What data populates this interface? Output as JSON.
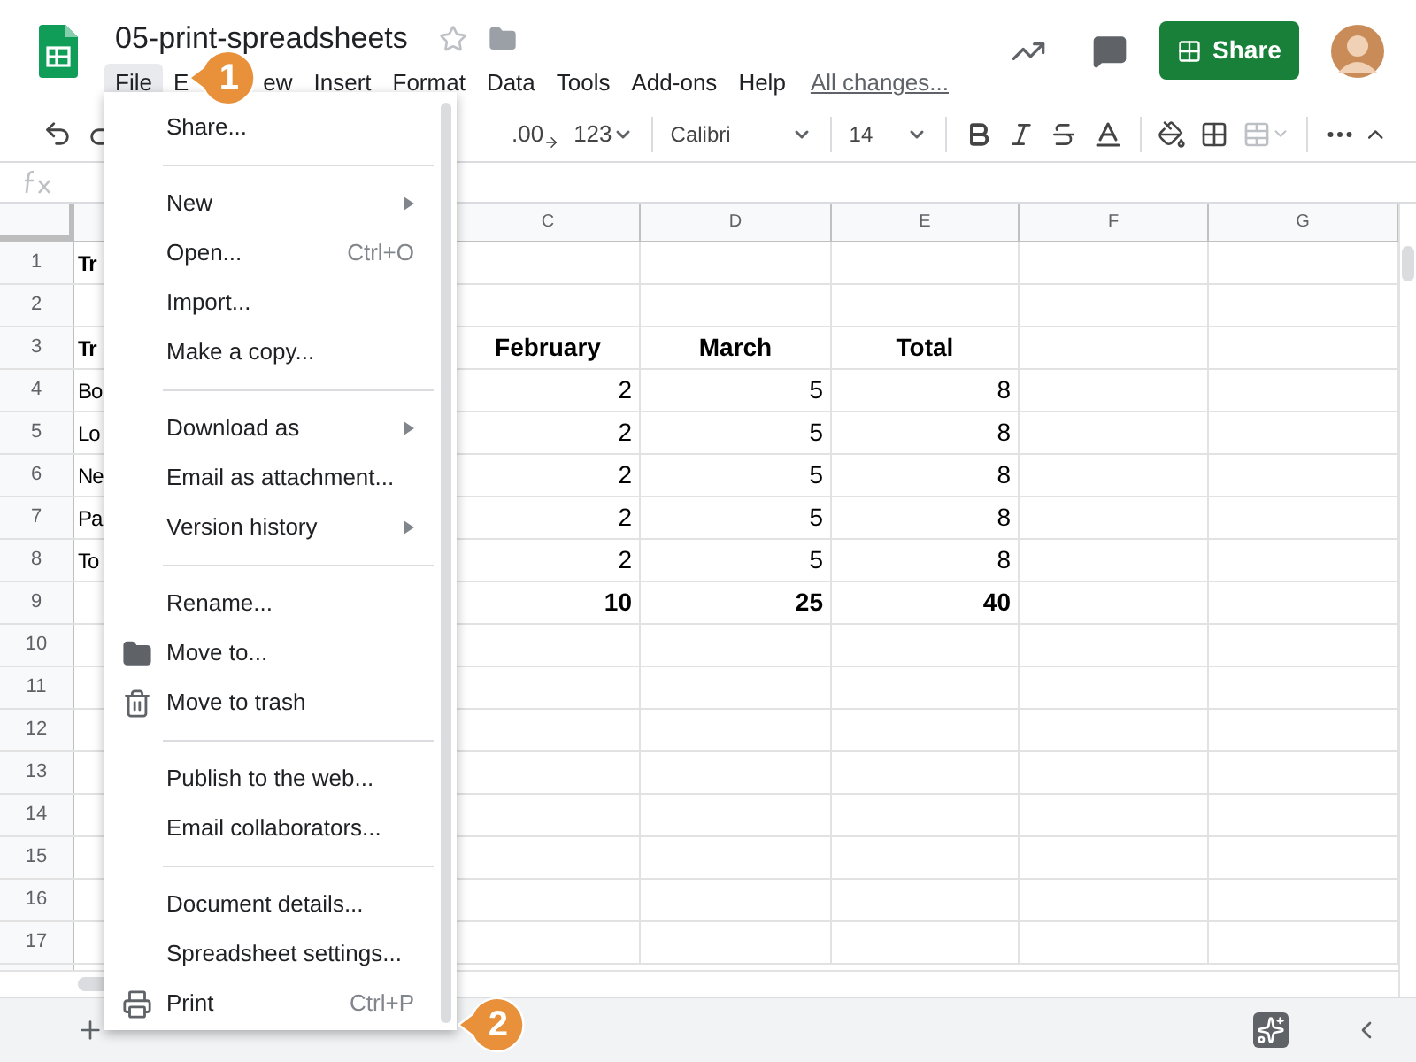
{
  "document": {
    "title": "05-print-spreadsheets"
  },
  "menu_bar": [
    {
      "label": "File",
      "selected": true
    },
    {
      "label": "E",
      "selected": false
    },
    {
      "label": "ew",
      "selected": false
    },
    {
      "label": "Insert",
      "selected": false
    },
    {
      "label": "Format",
      "selected": false
    },
    {
      "label": "Data",
      "selected": false
    },
    {
      "label": "Tools",
      "selected": false
    },
    {
      "label": "Add-ons",
      "selected": false
    },
    {
      "label": "Help",
      "selected": false
    }
  ],
  "save_status": "All changes...",
  "share_button": "Share",
  "toolbar": {
    "decimal": ".00",
    "number_format": "123",
    "font": "Calibri",
    "font_size": "14"
  },
  "column_headers": [
    "C",
    "D",
    "E",
    "F",
    "G"
  ],
  "rows": [
    {
      "number": "1",
      "kind": "title",
      "a": "Tr"
    },
    {
      "number": "2",
      "kind": "empty"
    },
    {
      "number": "3",
      "kind": "header",
      "a": "Tr",
      "c": "February",
      "d": "March",
      "e": "Total"
    },
    {
      "number": "4",
      "kind": "data",
      "a": "Bo",
      "c": "2",
      "d": "5",
      "e": "8"
    },
    {
      "number": "5",
      "kind": "data",
      "a": "Lo",
      "c": "2",
      "d": "5",
      "e": "8"
    },
    {
      "number": "6",
      "kind": "data",
      "a": "Ne",
      "c": "2",
      "d": "5",
      "e": "8"
    },
    {
      "number": "7",
      "kind": "data",
      "a": "Pa",
      "c": "2",
      "d": "5",
      "e": "8"
    },
    {
      "number": "8",
      "kind": "data",
      "a": "To",
      "c": "2",
      "d": "5",
      "e": "8"
    },
    {
      "number": "9",
      "kind": "total",
      "c": "10",
      "d": "25",
      "e": "40"
    },
    {
      "number": "10",
      "kind": "empty"
    },
    {
      "number": "11",
      "kind": "empty"
    },
    {
      "number": "12",
      "kind": "empty"
    },
    {
      "number": "13",
      "kind": "empty"
    },
    {
      "number": "14",
      "kind": "empty"
    },
    {
      "number": "15",
      "kind": "empty"
    },
    {
      "number": "16",
      "kind": "empty"
    },
    {
      "number": "17",
      "kind": "empty"
    }
  ],
  "file_menu": [
    {
      "kind": "item",
      "label": "Share..."
    },
    {
      "kind": "separator"
    },
    {
      "kind": "item",
      "label": "New",
      "submenu": true
    },
    {
      "kind": "item",
      "label": "Open...",
      "shortcut": "Ctrl+O"
    },
    {
      "kind": "item",
      "label": "Import..."
    },
    {
      "kind": "item",
      "label": "Make a copy..."
    },
    {
      "kind": "separator"
    },
    {
      "kind": "item",
      "label": "Download as",
      "submenu": true
    },
    {
      "kind": "item",
      "label": "Email as attachment..."
    },
    {
      "kind": "item",
      "label": "Version history",
      "submenu": true
    },
    {
      "kind": "separator"
    },
    {
      "kind": "item",
      "label": "Rename..."
    },
    {
      "kind": "folder_item",
      "label": "Move to..."
    },
    {
      "kind": "trash_item",
      "label": "Move to trash"
    },
    {
      "kind": "separator"
    },
    {
      "kind": "item",
      "label": "Publish to the web..."
    },
    {
      "kind": "item",
      "label": "Email collaborators..."
    },
    {
      "kind": "separator"
    },
    {
      "kind": "item",
      "label": "Document details..."
    },
    {
      "kind": "item",
      "label": "Spreadsheet settings..."
    },
    {
      "kind": "print_item",
      "label": "Print",
      "shortcut": "Ctrl+P"
    }
  ],
  "callouts": [
    "1",
    "2"
  ]
}
